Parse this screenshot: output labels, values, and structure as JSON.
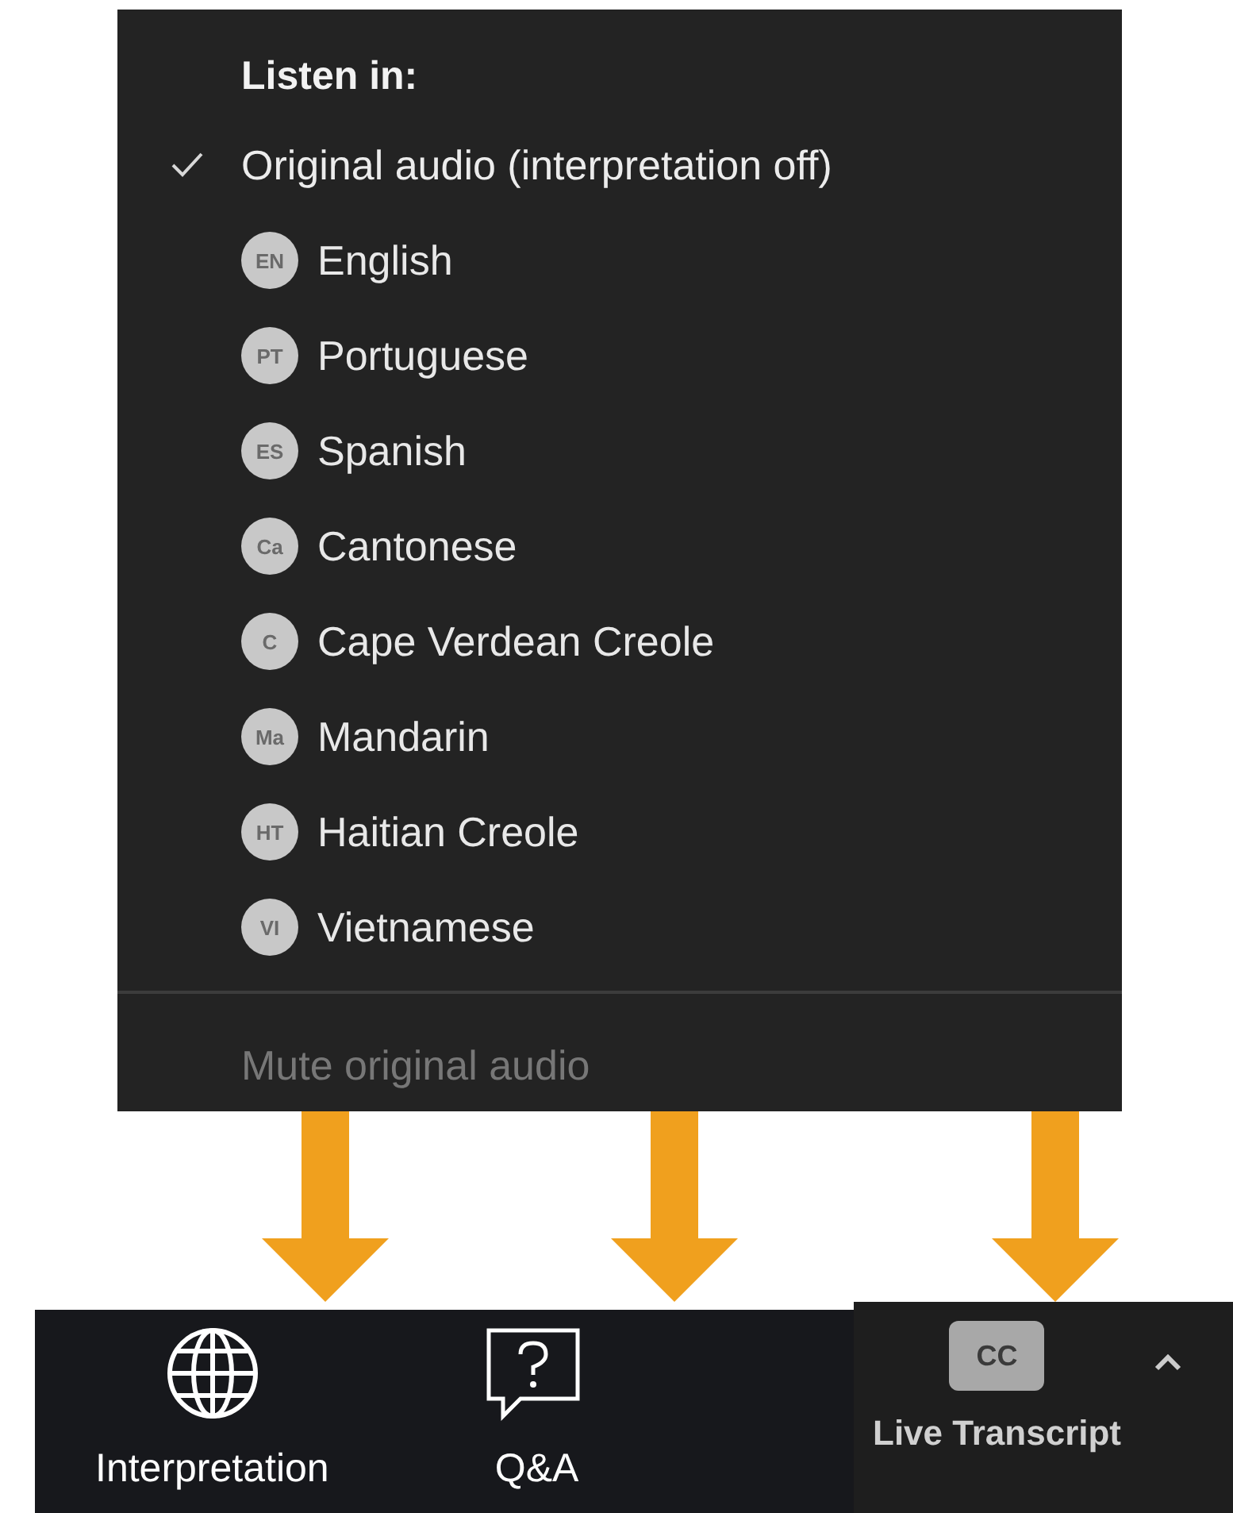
{
  "menu": {
    "heading": "Listen in:",
    "items": [
      {
        "kind": "check",
        "label": "Original audio (interpretation off)",
        "selected": true
      },
      {
        "kind": "language",
        "badge": "EN",
        "label": "English",
        "selected": false
      },
      {
        "kind": "language",
        "badge": "PT",
        "label": "Portuguese",
        "selected": false
      },
      {
        "kind": "language",
        "badge": "ES",
        "label": "Spanish",
        "selected": false
      },
      {
        "kind": "language",
        "badge": "Ca",
        "label": "Cantonese",
        "selected": false
      },
      {
        "kind": "language",
        "badge": "C",
        "label": "Cape Verdean Creole",
        "selected": false
      },
      {
        "kind": "language",
        "badge": "Ma",
        "label": "Mandarin",
        "selected": false
      },
      {
        "kind": "language",
        "badge": "HT",
        "label": "Haitian Creole",
        "selected": false
      },
      {
        "kind": "language",
        "badge": "VI",
        "label": "Vietnamese",
        "selected": false
      }
    ],
    "footer": {
      "label": "Mute original audio",
      "disabled": true
    }
  },
  "toolbar": {
    "buttons": [
      {
        "kind": "globe",
        "label": "Interpretation"
      },
      {
        "kind": "question",
        "label": "Q&A"
      }
    ],
    "transcript": {
      "badge": "CC",
      "label": "Live Transcript"
    }
  }
}
